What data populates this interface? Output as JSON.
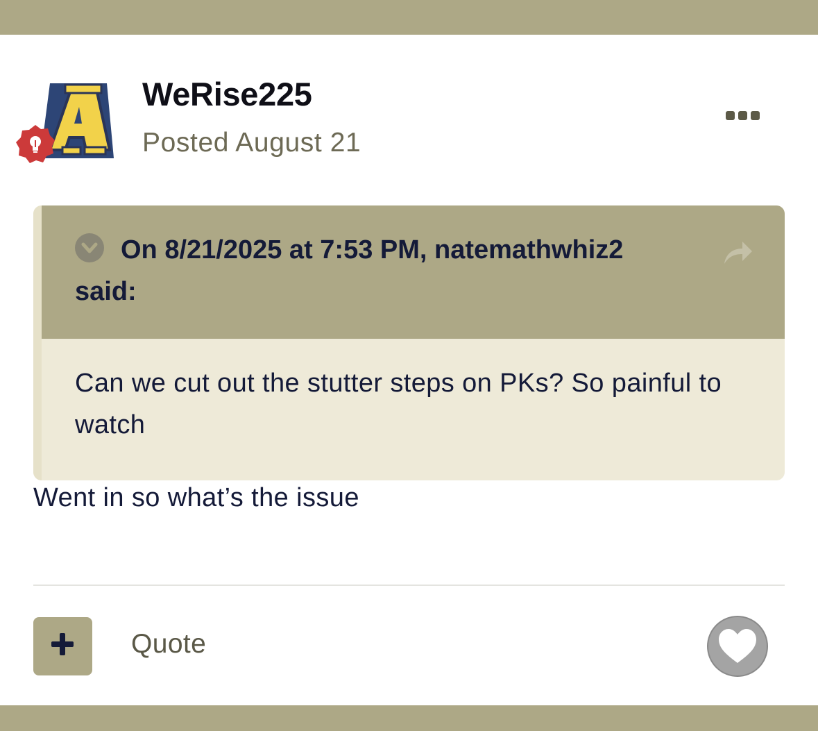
{
  "post": {
    "author": "WeRise225",
    "posted": "Posted August 21",
    "avatar_icon": "team-logo-a",
    "badge_icon": "lightbulb-icon",
    "reply": "Went in so what’s the issue"
  },
  "quote": {
    "citation": "On 8/21/2025 at 7:53 PM, natemathwhiz2 said:",
    "text": "Can we cut out the stutter steps on PKs? So painful to watch"
  },
  "actions": {
    "quote_label": "Quote",
    "add_icon": "plus-icon",
    "like_icon": "heart-icon",
    "more_icon": "ellipsis-icon"
  },
  "colors": {
    "accent": "#ada886",
    "quote_body": "#eeead8",
    "text_dark": "#141a38",
    "text_muted": "#6d6a55",
    "badge_red": "#cc3a3a"
  }
}
